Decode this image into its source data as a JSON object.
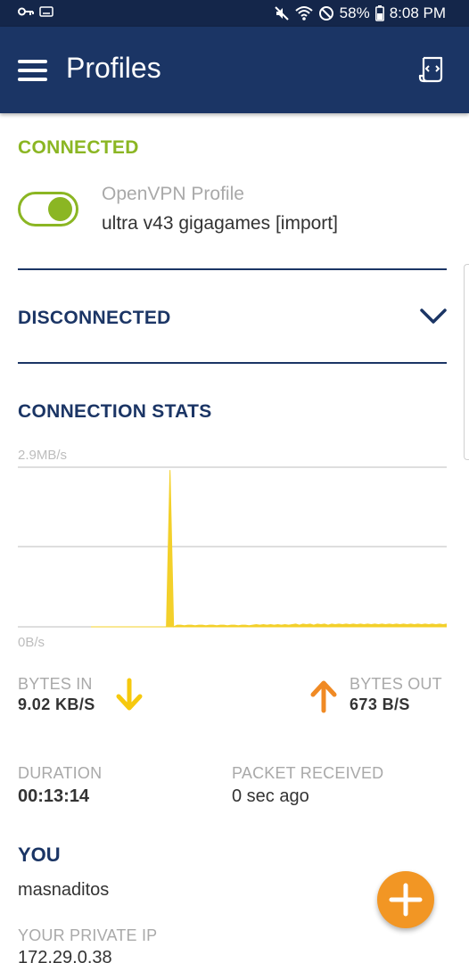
{
  "status_bar": {
    "icons": [
      "vpn-key-icon",
      "keyboard-icon",
      "mute-icon",
      "wifi-icon",
      "do-not-disturb-icon",
      "battery-icon"
    ],
    "battery": "58%",
    "time": "8:08 PM"
  },
  "app_bar": {
    "title": "Profiles",
    "menu_icon": "menu-icon",
    "action_icon": "import-profile-icon"
  },
  "connected": {
    "heading": "CONNECTED",
    "toggle_on": true,
    "profile_type": "OpenVPN Profile",
    "profile_name": "ultra v43 gigagames [import]"
  },
  "disconnected": {
    "heading": "DISCONNECTED",
    "expand_icon": "chevron-down-icon"
  },
  "stats": {
    "heading": "CONNECTION STATS",
    "graph_max_label": "2.9MB/s",
    "graph_min_label": "0B/s",
    "bytes_in_label": "BYTES IN",
    "bytes_in_value": "9.02 KB/S",
    "bytes_out_label": "BYTES OUT",
    "bytes_out_value": "673 B/S",
    "duration_label": "DURATION",
    "duration_value": "00:13:14",
    "packet_label": "PACKET RECEIVED",
    "packet_value": "0 sec ago"
  },
  "you": {
    "heading": "YOU",
    "username": "masnaditos",
    "private_ip_label": "YOUR PRIVATE IP",
    "private_ip_value": "172.29.0.38"
  },
  "colors": {
    "primary": "#1b3565",
    "connected_green": "#8bb623",
    "graph_yellow": "#f3d02a",
    "bytes_in_arrow": "#f6c90e",
    "bytes_out_arrow": "#f08a24",
    "fab": "#f29624"
  },
  "chart_data": {
    "type": "area",
    "ylim": [
      0,
      2.9
    ],
    "y_unit": "MB/s",
    "grid": true,
    "values": [
      0,
      0,
      0,
      0,
      0,
      0,
      0,
      0,
      0,
      0,
      0,
      0,
      0,
      0,
      0,
      0,
      0,
      0,
      0,
      0,
      0,
      0,
      2.85,
      0,
      0.03,
      0.03,
      0.02,
      0.03,
      0.03,
      0.02,
      0.03,
      0.03,
      0.02,
      0.03,
      0.03,
      0.02,
      0.03,
      0.03,
      0.02,
      0.03,
      0.03,
      0.02,
      0.03,
      0.03,
      0.02,
      0.03,
      0.04,
      0.03,
      0.04,
      0.03,
      0.04,
      0.03,
      0.04,
      0.03,
      0.04,
      0.03,
      0.04,
      0.05,
      0.03,
      0.05,
      0.04,
      0.05,
      0.03,
      0.05,
      0.04,
      0.05,
      0.03,
      0.05,
      0.04,
      0.05,
      0.04,
      0.05,
      0.04,
      0.05,
      0.04,
      0.05,
      0.04,
      0.05,
      0.04,
      0.05,
      0.04,
      0.05,
      0.04,
      0.05,
      0.04,
      0.05,
      0.04,
      0.05,
      0.04,
      0.05,
      0.04,
      0.05,
      0.04,
      0.05,
      0.04,
      0.05,
      0.04,
      0.05,
      0.04,
      0.05
    ]
  },
  "fab": {
    "icon": "plus-icon"
  }
}
